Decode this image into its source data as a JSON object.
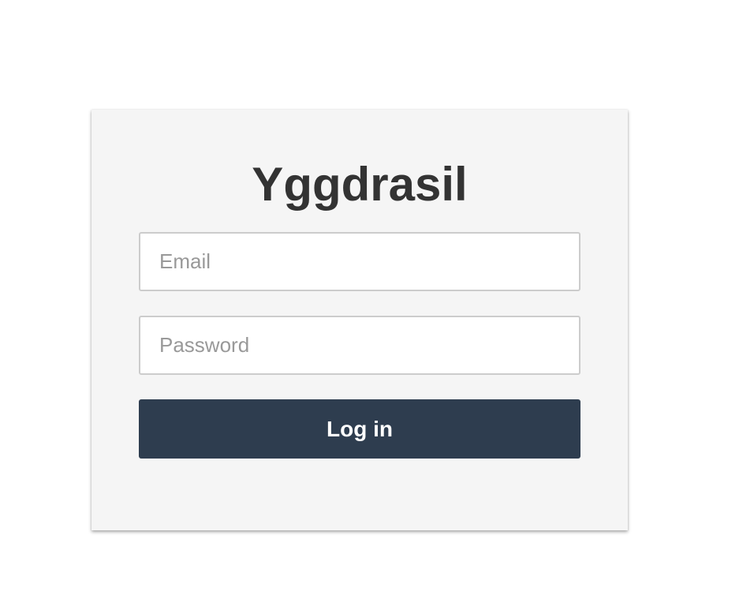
{
  "login": {
    "title": "Yggdrasil",
    "email_placeholder": "Email",
    "password_placeholder": "Password",
    "submit_label": "Log in"
  }
}
